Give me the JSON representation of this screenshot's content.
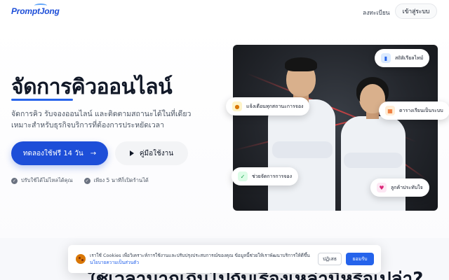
{
  "header": {
    "logo": "PromptJong",
    "register_label": "ลงทะเบียน",
    "login_label": "เข้าสู่ระบบ"
  },
  "hero": {
    "title": "จัดการคิวออนไลน์",
    "subtitle_line1": "จัดการคิว รับจองออนไลน์ และติดตามสถานะได้ในที่เดียว",
    "subtitle_line2": "เหมาะสำหรับธุรกิจบริการที่ต้องการประหยัดเวลา",
    "primary_button": "ทดลองใช้ฟรี 14 วัน",
    "secondary_button": "คู่มือใช้งาน",
    "features": [
      "ปรับใช้ได้ไม่ไหลได้คุณ",
      "เพียง 5 นาทีก็เปิดร้านได้"
    ]
  },
  "chips": {
    "stats": "สถิติเรียลไทม์",
    "notify": "แจ้งเตือนทุกสถานะการจอง",
    "schedule": "ตารางเรียนเป็นระบบ",
    "manage": "ช่วยจัดการการจอง",
    "loyal": "ลูกค้าประทับใจ"
  },
  "icons": {
    "stats": "bar-chart-icon",
    "notify": "bell-icon",
    "schedule": "calendar-icon",
    "manage": "check-circle-icon",
    "loyal": "heart-icon"
  },
  "next_section": {
    "heading": "ใช้เวลามากเกินไปกับเรื่องเหล่านี้หรือเปล่า?"
  },
  "cookie": {
    "text": "เราใช้ Cookies เพื่อวิเคราะห์การใช้งานและปรับปรุงประสบการณ์ของคุณ ข้อมูลนี้ช่วยให้เราพัฒนาบริการให้ดีขึ้น",
    "link": "นโยบายความเป็นส่วนตัว",
    "decline": "ปฏิเสธ",
    "accept": "ยอมรับ"
  },
  "colors": {
    "primary": "#1d4ed8",
    "accent": "#2563eb",
    "dark_panel": "#24272d"
  }
}
